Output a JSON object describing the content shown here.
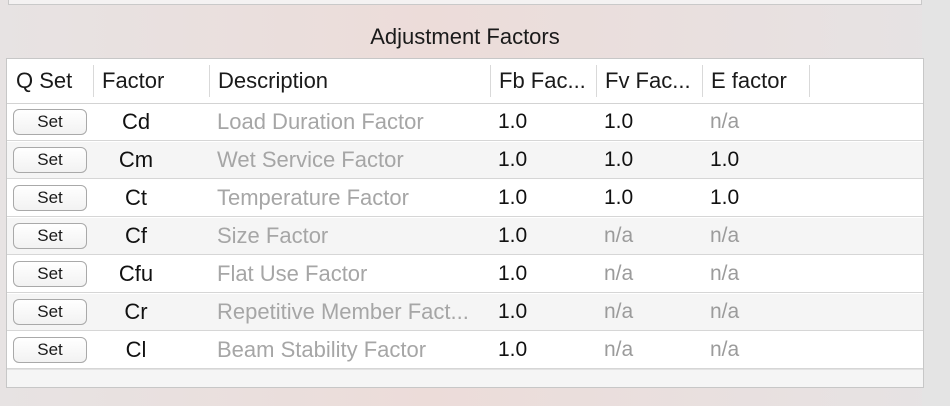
{
  "section": {
    "title": "Adjustment Factors"
  },
  "table": {
    "columns": {
      "qset": "Q Set",
      "factor": "Factor",
      "description": "Description",
      "fb": "Fb Fac...",
      "fv": "Fv Fac...",
      "e": "E factor"
    },
    "rows": [
      {
        "button": "Set",
        "factor": "Cd",
        "description": "Load Duration Factor",
        "fb": "1.0",
        "fv": "1.0",
        "e": "n/a"
      },
      {
        "button": "Set",
        "factor": "Cm",
        "description": "Wet Service Factor",
        "fb": "1.0",
        "fv": "1.0",
        "e": "1.0"
      },
      {
        "button": "Set",
        "factor": "Ct",
        "description": "Temperature Factor",
        "fb": "1.0",
        "fv": "1.0",
        "e": "1.0"
      },
      {
        "button": "Set",
        "factor": "Cf",
        "description": "Size Factor",
        "fb": "1.0",
        "fv": "n/a",
        "e": "n/a"
      },
      {
        "button": "Set",
        "factor": "Cfu",
        "description": "Flat Use Factor",
        "fb": "1.0",
        "fv": "n/a",
        "e": "n/a"
      },
      {
        "button": "Set",
        "factor": "Cr",
        "description": "Repetitive Member Fact...",
        "fb": "1.0",
        "fv": "n/a",
        "e": "n/a"
      },
      {
        "button": "Set",
        "factor": "Cl",
        "description": "Beam Stability Factor",
        "fb": "1.0",
        "fv": "n/a",
        "e": "n/a"
      }
    ]
  }
}
